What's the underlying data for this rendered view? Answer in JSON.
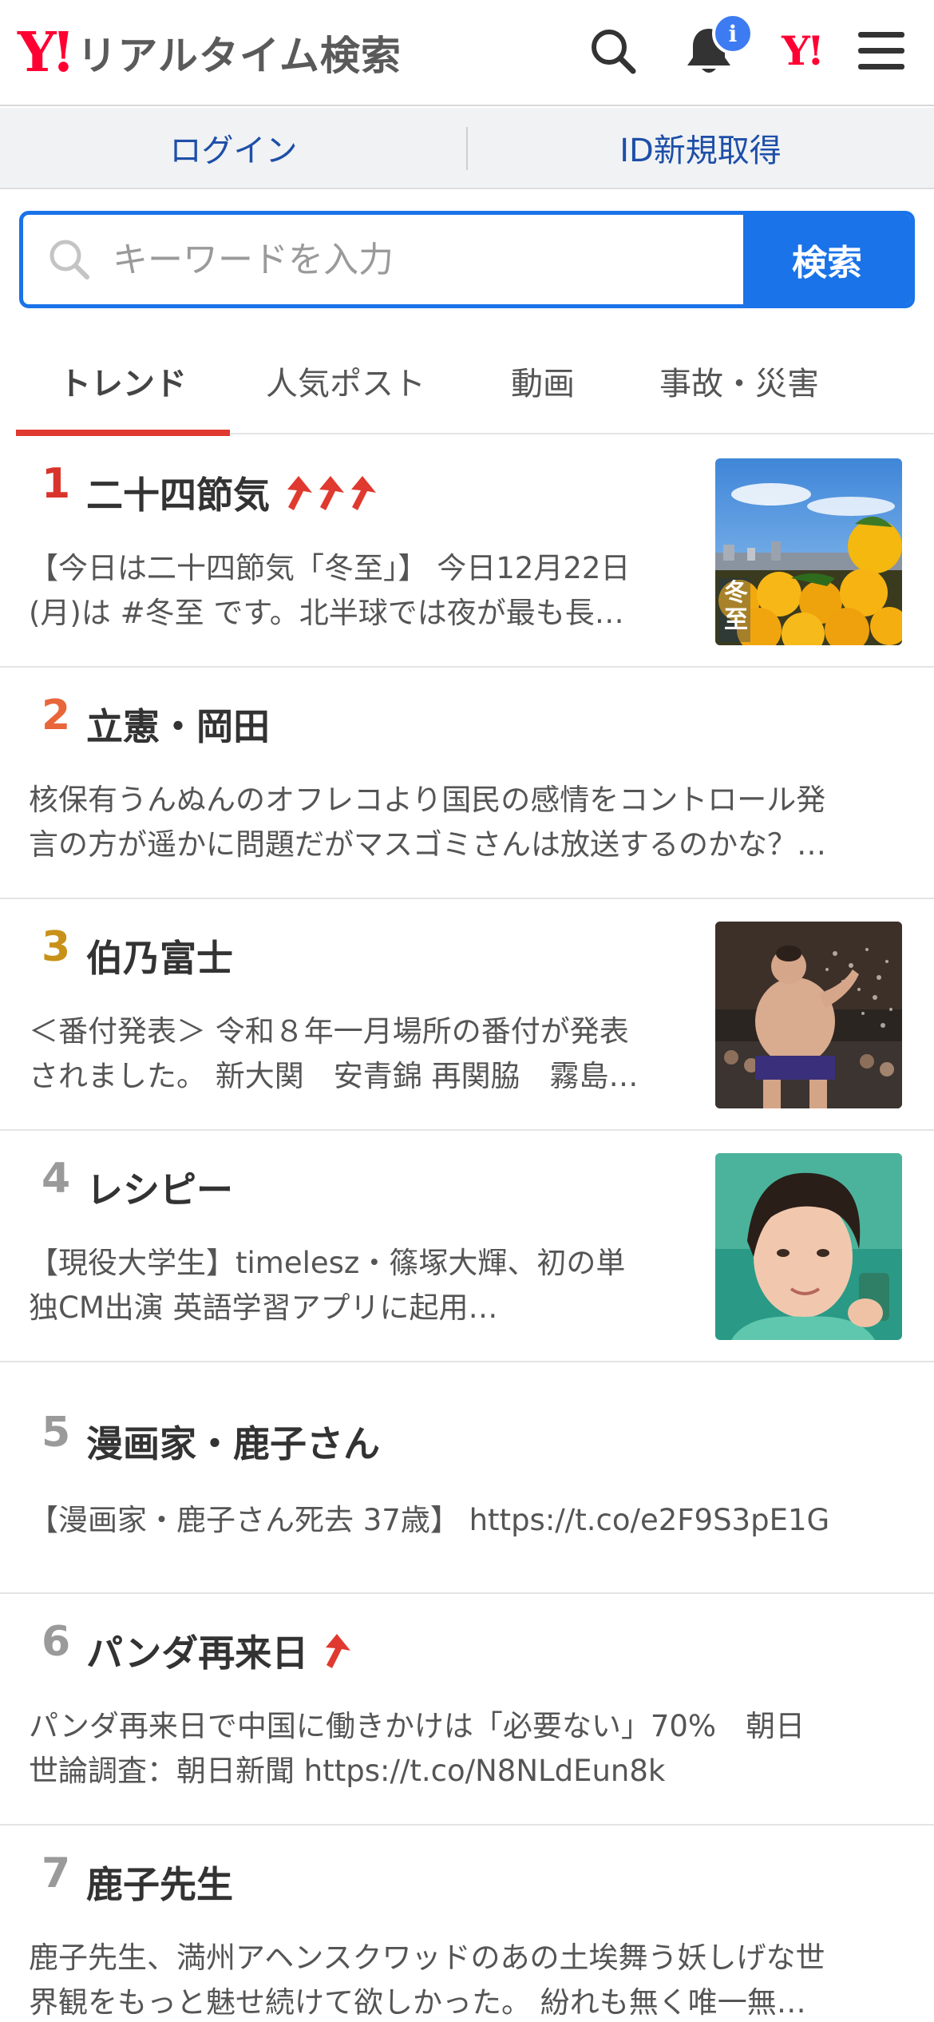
{
  "header": {
    "brand": "Y!",
    "title": "リアルタイム検索",
    "notification_badge": "i",
    "yj_mark": "Y!"
  },
  "login_bar": {
    "login": "ログイン",
    "register": "ID新規取得"
  },
  "search": {
    "placeholder": "キーワードを入力",
    "button": "検索"
  },
  "tabs": [
    {
      "label": "トレンド",
      "active": true
    },
    {
      "label": "人気ポスト",
      "active": false
    },
    {
      "label": "動画",
      "active": false
    },
    {
      "label": "事故・災害",
      "active": false
    }
  ],
  "trends": [
    {
      "rank": "1",
      "title": "二十四節気",
      "arrows": 3,
      "line1": "【今日は二十四節気「冬至」】 今日12月22日",
      "line2": "(月)は #冬至 です。北半球では夜が最も長…",
      "thumb_text": "冬至"
    },
    {
      "rank": "2",
      "title": "立憲・岡田",
      "arrows": 0,
      "line1": "核保有うんぬんのオフレコより国民の感情をコントロール発",
      "line2": "言の方が遥かに問題だがマスゴミさんは放送するのかな？…"
    },
    {
      "rank": "3",
      "title": "伯乃富士",
      "arrows": 0,
      "line1": "＜番付発表＞ 令和８年一月場所の番付が発表",
      "line2": "されました。 新大関　安青錦 再関脇　霧島…"
    },
    {
      "rank": "4",
      "title": "レシピー",
      "arrows": 0,
      "line1": "【現役大学生】timelesz・篠塚大輝、初の単",
      "line2": "独CM出演 英語学習アプリに起用…"
    },
    {
      "rank": "5",
      "title": "漫画家・鹿子さん",
      "arrows": 0,
      "line1": "【漫画家・鹿子さん死去 37歳】 https://t.co/e2F9S3pE1G",
      "line2": ""
    },
    {
      "rank": "6",
      "title": "パンダ再来日",
      "arrows": 1,
      "line1": "パンダ再来日で中国に働きかけは「必要ない」70%　朝日",
      "line2": "世論調査：朝日新聞 https://t.co/N8NLdEun8k"
    },
    {
      "rank": "7",
      "title": "鹿子先生",
      "arrows": 0,
      "line1": "鹿子先生、満州アヘンスクワッドのあの土埃舞う妖しげな世",
      "line2": "界観をもっと魅せ続けて欲しかった。 紛れも無く唯一無…"
    }
  ],
  "colors": {
    "accent_blue": "#1a73e8",
    "brand_red": "#ff0033",
    "rank1": "#d9342b",
    "rank2": "#e8663a",
    "rank3": "#c8911a",
    "rank_other": "#9a9a9a",
    "tab_indicator": "#e0392f",
    "trend_arrow": "#e0392f"
  },
  "icons": [
    "search-icon",
    "bell-icon",
    "yahoo-japan-icon",
    "hamburger-menu-icon",
    "trend-up-arrow-icon"
  ]
}
